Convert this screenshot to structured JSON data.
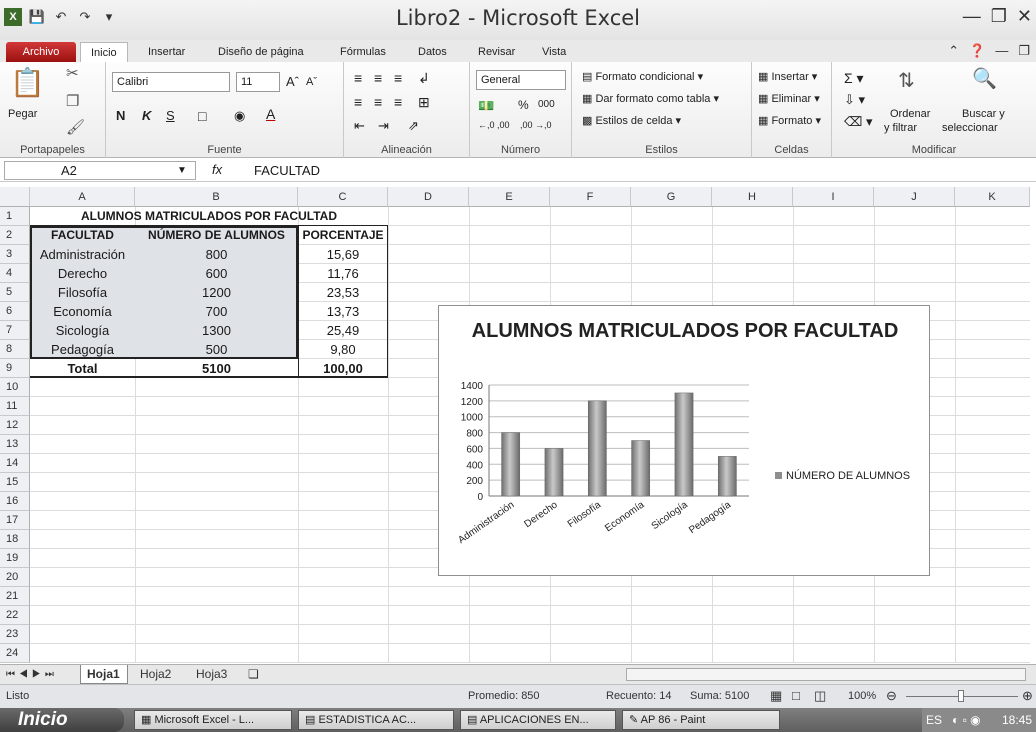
{
  "window": {
    "title": "Libro2 - Microsoft Excel"
  },
  "tabs": [
    "Archivo",
    "Inicio",
    "Insertar",
    "Diseño de página",
    "Fórmulas",
    "Datos",
    "Revisar",
    "Vista"
  ],
  "ribbon": {
    "portapapeles": {
      "paste": "Pegar",
      "label": "Portapapeles"
    },
    "fuente": {
      "font": "Calibri",
      "size": "11",
      "bold": "N",
      "italic": "K",
      "underline": "S",
      "label": "Fuente"
    },
    "alineacion": {
      "label": "Alineación"
    },
    "numero": {
      "format": "General",
      "percent": "%",
      "thousands": "000",
      "dec_inc": "←,0 ,00",
      "dec_dec": ",00 →,0",
      "label": "Número"
    },
    "estilos": {
      "cond": "Formato condicional",
      "table": "Dar formato como tabla",
      "cell": "Estilos de celda",
      "label": "Estilos"
    },
    "celdas": {
      "insert": "Insertar",
      "delete": "Eliminar",
      "format": "Formato",
      "label": "Celdas"
    },
    "modificar": {
      "sort1": "Ordenar",
      "sort2": "y filtrar",
      "find1": "Buscar y",
      "find2": "seleccionar",
      "label": "Modificar"
    }
  },
  "formula_bar": {
    "name_box": "A2",
    "fx": "fx",
    "content": "FACULTAD"
  },
  "columns": [
    "A",
    "B",
    "C",
    "D",
    "E",
    "F",
    "G",
    "H",
    "I",
    "J",
    "K"
  ],
  "rows": [
    "1",
    "2",
    "3",
    "4",
    "5",
    "6",
    "7",
    "8",
    "9",
    "10",
    "11",
    "12",
    "13",
    "14",
    "15",
    "16",
    "17",
    "18",
    "19",
    "20",
    "21",
    "22",
    "23",
    "24"
  ],
  "sheet": {
    "title": "ALUMNOS MATRICULADOS POR FACULTAD",
    "headers": [
      "FACULTAD",
      "NÚMERO DE ALUMNOS",
      "PORCENTAJE"
    ],
    "data": [
      [
        "Administración",
        "800",
        "15,69"
      ],
      [
        "Derecho",
        "600",
        "11,76"
      ],
      [
        "Filosofía",
        "1200",
        "23,53"
      ],
      [
        "Economía",
        "700",
        "13,73"
      ],
      [
        "Sicología",
        "1300",
        "25,49"
      ],
      [
        "Pedagogía",
        "500",
        "9,80"
      ]
    ],
    "total": [
      "Total",
      "5100",
      "100,00"
    ]
  },
  "chart_data": {
    "type": "bar",
    "title": "ALUMNOS MATRICULADOS POR FACULTAD",
    "categories": [
      "Administración",
      "Derecho",
      "Filosofía",
      "Economía",
      "Sicología",
      "Pedagogía"
    ],
    "series": [
      {
        "name": "NÚMERO DE ALUMNOS",
        "values": [
          800,
          600,
          1200,
          700,
          1300,
          500
        ]
      }
    ],
    "yticks": [
      "0",
      "200",
      "400",
      "600",
      "800",
      "1000",
      "1200",
      "1400"
    ],
    "ylim": [
      0,
      1400
    ],
    "grid": true,
    "legend": "right",
    "bar_color": "#8e8e8e"
  },
  "sheet_tabs": [
    "Hoja1",
    "Hoja2",
    "Hoja3"
  ],
  "status": {
    "ready": "Listo",
    "average": "Promedio: 850",
    "count": "Recuento: 14",
    "sum": "Suma: 5100",
    "zoom": "100%"
  },
  "taskbar": {
    "start": "Inicio",
    "items": [
      "Microsoft Excel - L...",
      "ESTADISTICA AC...",
      "APLICACIONES EN...",
      "AP 86 - Paint"
    ],
    "lang": "ES",
    "clock": "18:45"
  }
}
